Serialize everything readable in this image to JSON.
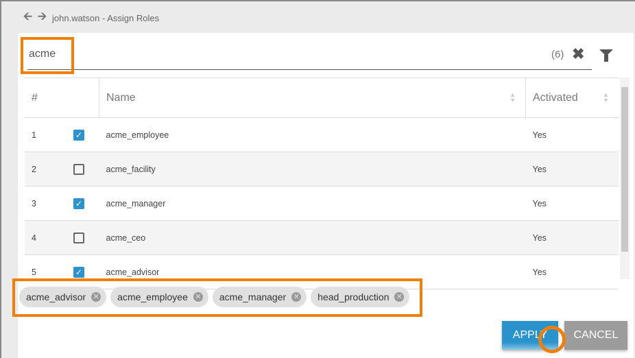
{
  "header": {
    "title": "john.watson - Assign Roles"
  },
  "search": {
    "value": "acme",
    "count": "(6)"
  },
  "table": {
    "columns": [
      "#",
      "Name",
      "Activated"
    ],
    "rows": [
      {
        "n": "1",
        "checked": true,
        "name": "acme_employee",
        "activated": "Yes"
      },
      {
        "n": "2",
        "checked": false,
        "name": "acme_facility",
        "activated": "Yes"
      },
      {
        "n": "3",
        "checked": true,
        "name": "acme_manager",
        "activated": "Yes"
      },
      {
        "n": "4",
        "checked": false,
        "name": "acme_ceo",
        "activated": "Yes"
      },
      {
        "n": "5",
        "checked": true,
        "name": "acme_advisor",
        "activated": "Yes"
      }
    ]
  },
  "chips": [
    "acme_advisor",
    "acme_employee",
    "acme_manager",
    "head_production"
  ],
  "buttons": {
    "apply": "APPLY",
    "cancel": "CANCEL"
  },
  "colors": {
    "highlight": "#f07f09",
    "primary": "#2d93cf"
  }
}
